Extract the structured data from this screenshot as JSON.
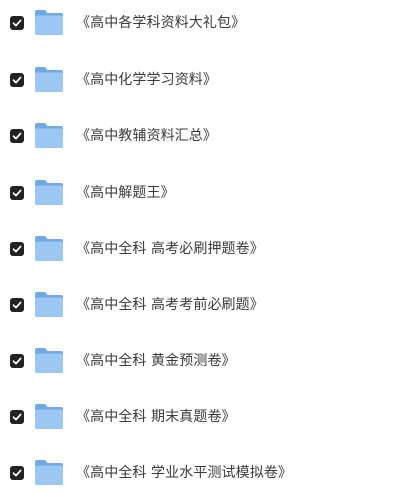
{
  "file_list": {
    "items": [
      {
        "label": "《高中各学科资料大礼包》",
        "checked": true,
        "icon": "folder-icon"
      },
      {
        "label": "《高中化学学习资料》",
        "checked": true,
        "icon": "folder-icon"
      },
      {
        "label": "《高中教辅资料汇总》",
        "checked": true,
        "icon": "folder-icon"
      },
      {
        "label": "《高中解题王》",
        "checked": true,
        "icon": "folder-icon"
      },
      {
        "label": "《高中全科 高考必刷押题卷》",
        "checked": true,
        "icon": "folder-icon"
      },
      {
        "label": "《高中全科 高考考前必刷题》",
        "checked": true,
        "icon": "folder-icon"
      },
      {
        "label": "《高中全科 黄金预测卷》",
        "checked": true,
        "icon": "folder-icon"
      },
      {
        "label": "《高中全科 期末真题卷》",
        "checked": true,
        "icon": "folder-icon"
      },
      {
        "label": "《高中全科 学业水平测试模拟卷》",
        "checked": true,
        "icon": "folder-icon"
      }
    ]
  },
  "colors": {
    "checkbox_fill": "#222222",
    "folder_light": "#9cc7f3",
    "folder_dark": "#6fa9e8",
    "text": "#3a3a3a"
  }
}
